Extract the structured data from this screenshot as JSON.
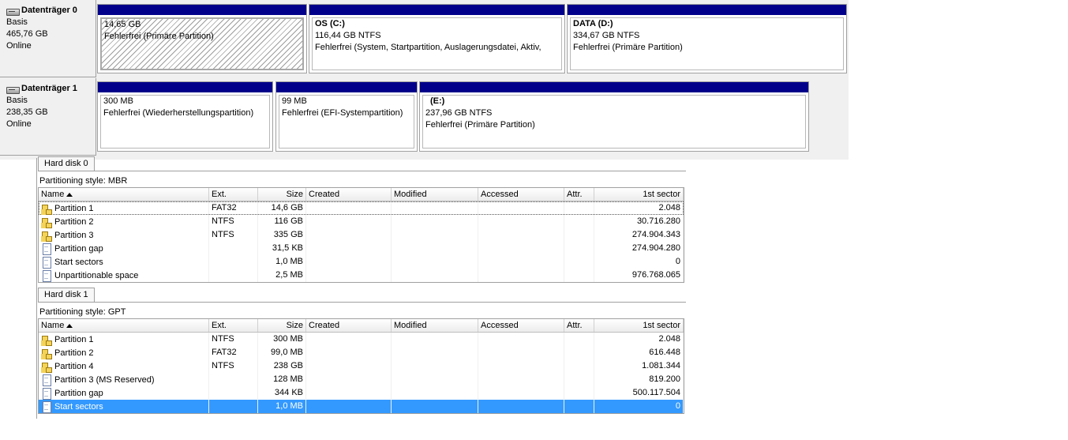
{
  "disk_management": {
    "disks": [
      {
        "name": "Datenträger 0",
        "type": "Basis",
        "size": "465,76 GB",
        "status": "Online",
        "partitions": [
          {
            "title": "",
            "size": "14,65 GB",
            "status": "Fehlerfrei (Primäre Partition)"
          },
          {
            "title": "OS  (C:)",
            "size": "116,44 GB NTFS",
            "status": "Fehlerfrei (System, Startpartition, Auslagerungsdatei, Aktiv,"
          },
          {
            "title": "DATA  (D:)",
            "size": "334,67 GB NTFS",
            "status": "Fehlerfrei (Primäre Partition)"
          }
        ]
      },
      {
        "name": "Datenträger 1",
        "type": "Basis",
        "size": "238,35 GB",
        "status": "Online",
        "partitions": [
          {
            "title": "",
            "size": "300 MB",
            "status": "Fehlerfrei (Wiederherstellungspartition)"
          },
          {
            "title": "",
            "size": "99 MB",
            "status": "Fehlerfrei (EFI-Systempartition)"
          },
          {
            "title": "(E:)",
            "size": "237,96 GB NTFS",
            "status": "Fehlerfrei (Primäre Partition)"
          }
        ]
      }
    ]
  },
  "columns": {
    "name": "Name",
    "ext": "Ext.",
    "size": "Size",
    "created": "Created",
    "modified": "Modified",
    "accessed": "Accessed",
    "attr": "Attr.",
    "sector": "1st sector"
  },
  "hard_disks": [
    {
      "tab": "Hard disk 0",
      "style": "Partitioning style: MBR",
      "rows": [
        {
          "icon": "partition-icon",
          "name": "Partition 1",
          "ext": "FAT32",
          "size": "14,6 GB",
          "sector": "2.048"
        },
        {
          "icon": "partition-icon",
          "name": "Partition 2",
          "ext": "NTFS",
          "size": "116 GB",
          "sector": "30.716.280"
        },
        {
          "icon": "partition-icon",
          "name": "Partition 3",
          "ext": "NTFS",
          "size": "335 GB",
          "sector": "274.904.343"
        },
        {
          "icon": "file-icon",
          "name": "Partition gap",
          "ext": "",
          "size": "31,5 KB",
          "sector": "274.904.280"
        },
        {
          "icon": "file-icon",
          "name": "Start sectors",
          "ext": "",
          "size": "1,0 MB",
          "sector": "0"
        },
        {
          "icon": "file-icon",
          "name": "Unpartitionable space",
          "ext": "",
          "size": "2,5 MB",
          "sector": "976.768.065"
        }
      ]
    },
    {
      "tab": "Hard disk 1",
      "style": "Partitioning style: GPT",
      "rows": [
        {
          "icon": "partition-icon",
          "name": "Partition 1",
          "ext": "NTFS",
          "size": "300 MB",
          "sector": "2.048"
        },
        {
          "icon": "partition-icon",
          "name": "Partition 2",
          "ext": "FAT32",
          "size": "99,0 MB",
          "sector": "616.448"
        },
        {
          "icon": "partition-icon",
          "name": "Partition 4",
          "ext": "NTFS",
          "size": "238 GB",
          "sector": "1.081.344"
        },
        {
          "icon": "file-icon",
          "name": "Partition 3 (MS Reserved)",
          "ext": "",
          "size": "128 MB",
          "sector": "819.200"
        },
        {
          "icon": "file-icon",
          "name": "Partition gap",
          "ext": "",
          "size": "344 KB",
          "sector": "500.117.504"
        },
        {
          "icon": "file-icon",
          "name": "Start sectors",
          "ext": "",
          "size": "1,0 MB",
          "sector": "0"
        }
      ]
    }
  ],
  "colors": {
    "partition_bar": "#00008a",
    "selection": "#3399ff"
  }
}
